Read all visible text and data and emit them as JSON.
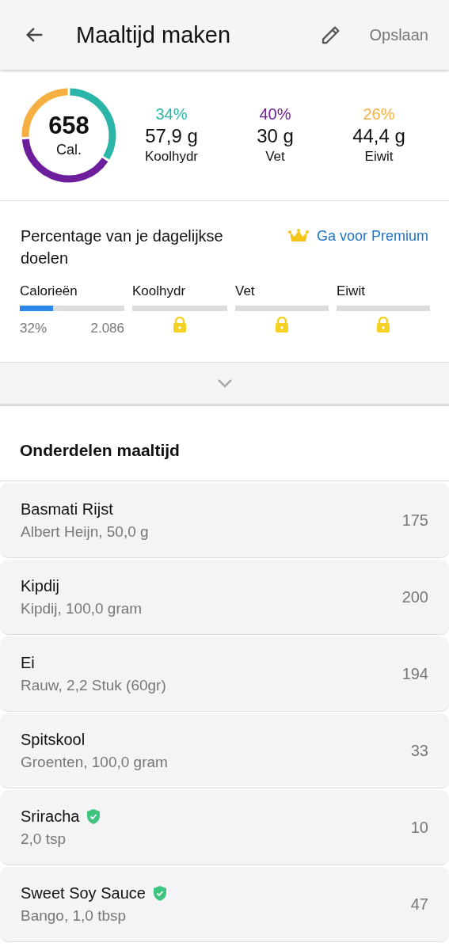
{
  "header": {
    "title": "Maaltijd maken",
    "save": "Opslaan"
  },
  "summary": {
    "calories": "658",
    "calories_unit": "Cal.",
    "macros": [
      {
        "percent": "34%",
        "amount": "57,9 g",
        "label": "Koolhydr",
        "color": "#2bb5a8"
      },
      {
        "percent": "40%",
        "amount": "30 g",
        "label": "Vet",
        "color": "#6e1e9c"
      },
      {
        "percent": "26%",
        "amount": "44,4 g",
        "label": "Eiwit",
        "color": "#f5b041"
      }
    ]
  },
  "goals": {
    "title": "Percentage van je dagelijkse doelen",
    "premium": "Ga voor Premium",
    "bars": [
      {
        "label": "Calorieën",
        "locked": false,
        "level": 0.32,
        "percent": "32%",
        "goal": "2.086"
      },
      {
        "label": "Koolhydr",
        "locked": true
      },
      {
        "label": "Vet",
        "locked": true
      },
      {
        "label": "Eiwit",
        "locked": true
      }
    ]
  },
  "section_title": "Onderdelen maaltijd",
  "items": [
    {
      "name": "Basmati Rijst",
      "detail": "Albert Heijn, 50,0 g",
      "calories": "175",
      "verified": false
    },
    {
      "name": "Kipdij",
      "detail": "Kipdij, 100,0 gram",
      "calories": "200",
      "verified": false
    },
    {
      "name": "Ei",
      "detail": "Rauw, 2,2 Stuk (60gr)",
      "calories": "194",
      "verified": false
    },
    {
      "name": "Spitskool",
      "detail": "Groenten, 100,0 gram",
      "calories": "33",
      "verified": false
    },
    {
      "name": "Sriracha",
      "detail": "2,0 tsp",
      "calories": "10",
      "verified": true
    },
    {
      "name": "Sweet Soy Sauce",
      "detail": "Bango, 1,0 tbsp",
      "calories": "47",
      "verified": true
    }
  ]
}
